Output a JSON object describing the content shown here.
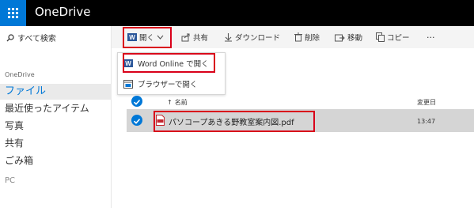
{
  "app": {
    "title": "OneDrive"
  },
  "sidebar": {
    "search_label": "すべて検索",
    "group_label": "OneDrive",
    "items": [
      {
        "label": "ファイル",
        "active": true
      },
      {
        "label": "最近使ったアイテム"
      },
      {
        "label": "写真"
      },
      {
        "label": "共有"
      },
      {
        "label": "ごみ箱"
      },
      {
        "label": "PC"
      }
    ]
  },
  "toolbar": {
    "open": "開く",
    "share": "共有",
    "download": "ダウンロード",
    "delete": "削除",
    "move": "移動",
    "copy": "コピー",
    "more": "···"
  },
  "open_menu": {
    "items": [
      {
        "label": "Word Online で開く",
        "icon": "word-icon"
      },
      {
        "label": "ブラウザーで開く",
        "icon": "browser-icon"
      }
    ]
  },
  "list": {
    "columns": {
      "name": "名前",
      "name_sort_arrow": "↑",
      "modified": "変更日"
    },
    "rows": [
      {
        "name": "パソコープあきる野教室案内図.pdf",
        "modified": "13:47",
        "selected": true,
        "icon": "pdf-file-icon"
      }
    ]
  },
  "colors": {
    "brand": "#0078d7",
    "highlight_box": "#d9001a",
    "selected_row": "#d5d5d5",
    "word": "#2b579a"
  }
}
